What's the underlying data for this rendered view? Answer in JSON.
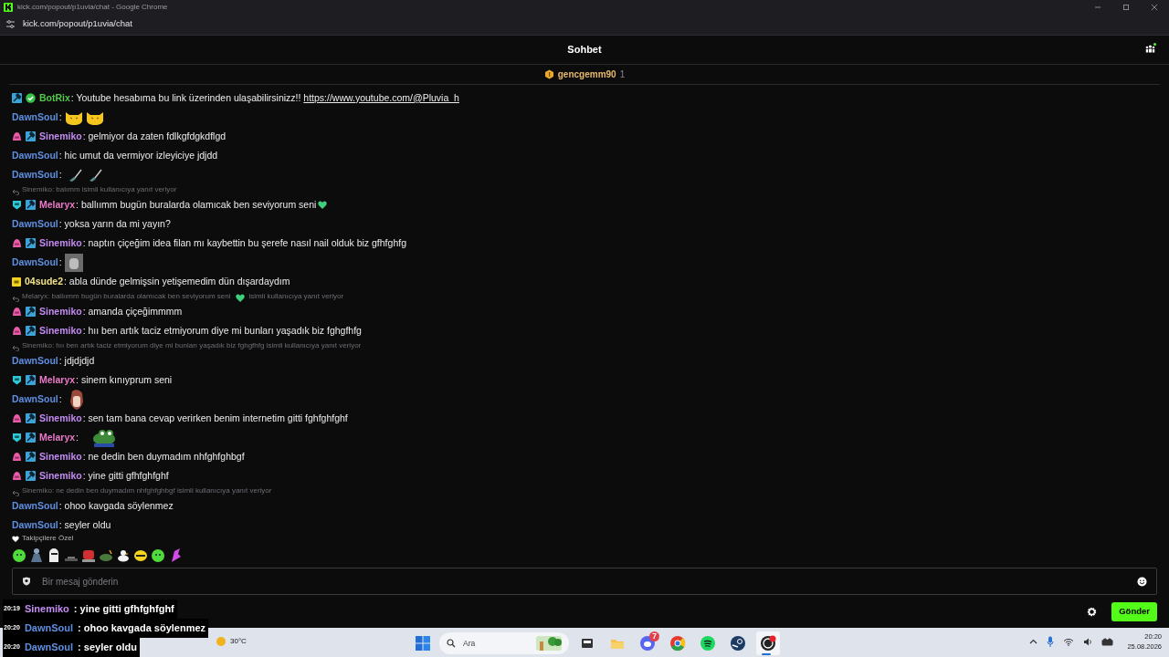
{
  "window": {
    "title": "kick.com/popout/p1uvia/chat - Google Chrome",
    "address": "kick.com/popout/p1uvia/chat"
  },
  "header": {
    "title": "Sohbet"
  },
  "pinned": {
    "name": "gencgemm90",
    "count": "1"
  },
  "messages": [
    {
      "badges": [
        {
          "kind": "hammer"
        },
        {
          "kind": "verified"
        }
      ],
      "name": "BotRix",
      "color": "#53c74a",
      "content": [
        {
          "kind": "text",
          "text": ": Youtube hesabıma bu link üzerinden ulaşabilirsinizz!! "
        },
        {
          "kind": "link",
          "text": "https://www.youtube.com/@Pluvia_h"
        }
      ]
    },
    {
      "name": "DawnSoul",
      "color": "#5f8fe0",
      "content": [
        {
          "kind": "text",
          "text": ":"
        },
        {
          "kind": "cat"
        },
        {
          "kind": "cat"
        }
      ]
    },
    {
      "badges": [
        {
          "kind": "sub-pink"
        },
        {
          "kind": "hammer"
        }
      ],
      "name": "Sinemiko",
      "color": "#c48cf2",
      "content": [
        {
          "kind": "text",
          "text": ": gelmiyor da zaten fdlkgfdgkdflgd"
        }
      ]
    },
    {
      "name": "DawnSoul",
      "color": "#5f8fe0",
      "content": [
        {
          "kind": "text",
          "text": ": hic umut da vermiyor izleyiciye jdjdd"
        }
      ]
    },
    {
      "name": "DawnSoul",
      "color": "#5f8fe0",
      "content": [
        {
          "kind": "text",
          "text": ":"
        },
        {
          "kind": "brush"
        },
        {
          "kind": "brush"
        }
      ]
    },
    {
      "reply": [
        {
          "kind": "text",
          "text": "Sinemiko: balımm isimli kullanıcıya yanıt veriyor"
        }
      ],
      "badges": [
        {
          "kind": "sub-teal"
        },
        {
          "kind": "hammer"
        }
      ],
      "name": "Melaryx",
      "color": "#ec79c8",
      "content": [
        {
          "kind": "text",
          "text": ": ballıımm bugün buralarda olamıcak ben seviyorum seni"
        },
        {
          "kind": "heart"
        }
      ]
    },
    {
      "name": "DawnSoul",
      "color": "#5f8fe0",
      "content": [
        {
          "kind": "text",
          "text": ": yoksa yarın da mi yayın?"
        }
      ]
    },
    {
      "badges": [
        {
          "kind": "sub-pink"
        },
        {
          "kind": "hammer"
        }
      ],
      "name": "Sinemiko",
      "color": "#c48cf2",
      "content": [
        {
          "kind": "text",
          "text": ": naptın çiçeğim idea filan mı kaybettin bu şerefe nasıl nail olduk biz gfhfghfg"
        }
      ]
    },
    {
      "name": "DawnSoul",
      "color": "#5f8fe0",
      "content": [
        {
          "kind": "text",
          "text": ":"
        },
        {
          "kind": "photo"
        }
      ]
    },
    {
      "badges": [
        {
          "kind": "sub-gold"
        }
      ],
      "name": "04sude2",
      "color": "#f2e38a",
      "content": [
        {
          "kind": "text",
          "text": ": abla dünde gelmişsin yetişemedim dün dışardaydım"
        }
      ]
    },
    {
      "reply": [
        {
          "kind": "text",
          "text": "Melaryx: ballıımm bugün buralarda olamıcak ben seviyorum seni"
        },
        {
          "kind": "heart"
        },
        {
          "kind": "text",
          "text": "isimli kullanıcıya yanıt veriyor"
        }
      ],
      "badges": [
        {
          "kind": "sub-pink"
        },
        {
          "kind": "hammer"
        }
      ],
      "name": "Sinemiko",
      "color": "#c48cf2",
      "content": [
        {
          "kind": "text",
          "text": ": amanda çiçeğimmmm"
        }
      ]
    },
    {
      "badges": [
        {
          "kind": "sub-pink"
        },
        {
          "kind": "hammer"
        }
      ],
      "name": "Sinemiko",
      "color": "#c48cf2",
      "content": [
        {
          "kind": "text",
          "text": ": hıı ben artık taciz etmiyorum diye mi bunları yaşadık biz fghgfhfg"
        }
      ]
    },
    {
      "reply": [
        {
          "kind": "text",
          "text": "Sinemiko: hıı ben artık taciz etmiyorum diye mi bunları yaşadık biz fghgfhfg isimli kullanıcıya yanıt veriyor"
        }
      ],
      "name": "DawnSoul",
      "color": "#5f8fe0",
      "content": [
        {
          "kind": "text",
          "text": ": jdjdjdjd"
        }
      ]
    },
    {
      "badges": [
        {
          "kind": "sub-teal"
        },
        {
          "kind": "hammer"
        }
      ],
      "name": "Melaryx",
      "color": "#ec79c8",
      "content": [
        {
          "kind": "text",
          "text": ": sinem kınıyprum seni"
        }
      ]
    },
    {
      "name": "DawnSoul",
      "color": "#5f8fe0",
      "content": [
        {
          "kind": "text",
          "text": ":"
        },
        {
          "kind": "anime"
        }
      ]
    },
    {
      "badges": [
        {
          "kind": "sub-pink"
        },
        {
          "kind": "hammer"
        }
      ],
      "name": "Sinemiko",
      "color": "#c48cf2",
      "content": [
        {
          "kind": "text",
          "text": ": sen tam bana cevap verirken benim internetim gitti fghfghfghf"
        }
      ]
    },
    {
      "badges": [
        {
          "kind": "sub-teal"
        },
        {
          "kind": "hammer"
        }
      ],
      "name": "Melaryx",
      "color": "#ec79c8",
      "content": [
        {
          "kind": "text",
          "text": ":"
        },
        {
          "kind": "frog"
        }
      ]
    },
    {
      "badges": [
        {
          "kind": "sub-pink"
        },
        {
          "kind": "hammer"
        }
      ],
      "name": "Sinemiko",
      "color": "#c48cf2",
      "content": [
        {
          "kind": "text",
          "text": ": ne dedin ben duymadım nhfghfghbgf"
        }
      ]
    },
    {
      "badges": [
        {
          "kind": "sub-pink"
        },
        {
          "kind": "hammer"
        }
      ],
      "name": "Sinemiko",
      "color": "#c48cf2",
      "content": [
        {
          "kind": "text",
          "text": ": yine gitti gfhfghfghf"
        }
      ]
    },
    {
      "reply": [
        {
          "kind": "text",
          "text": "Sinemiko: ne dedin ben duymadım nhfghfghbgf isimli kullanıcıya yanıt veriyor"
        }
      ],
      "name": "DawnSoul",
      "color": "#5f8fe0",
      "content": [
        {
          "kind": "text",
          "text": ": ohoo kavgada söylenmez"
        }
      ]
    },
    {
      "name": "DawnSoul",
      "color": "#5f8fe0",
      "content": [
        {
          "kind": "text",
          "text": ": seyler oldu"
        }
      ]
    }
  ],
  "followers_emotes": {
    "label": "Takipçilere Özel",
    "emotes": [
      {
        "kind": "blob"
      },
      {
        "kind": "person"
      },
      {
        "kind": "ghost"
      },
      {
        "kind": "hat"
      },
      {
        "kind": "monster"
      },
      {
        "kind": "turtle"
      },
      {
        "kind": "duck"
      },
      {
        "kind": "bee"
      },
      {
        "kind": "blob"
      },
      {
        "kind": "unicorn"
      }
    ]
  },
  "composer": {
    "placeholder": "Bir mesaj gönderin",
    "send": "Gönder"
  },
  "overlay_chat": [
    {
      "time": "20:19",
      "name": "Sinemiko",
      "color": "#c48cf2",
      "text": ": yine gitti gfhfghfghf"
    },
    {
      "time": "20:20",
      "name": "DawnSoul",
      "color": "#5f8fe0",
      "text": ": ohoo kavgada söylenmez"
    },
    {
      "time": "20:20",
      "name": "DawnSoul",
      "color": "#5f8fe0",
      "text": ": seyler oldu"
    }
  ],
  "taskbar": {
    "weather": "30°C",
    "search": "Ara",
    "apps": [
      {
        "kind": "taskview",
        "active": false
      },
      {
        "kind": "files",
        "active": false
      },
      {
        "kind": "discord",
        "active": false,
        "badge": "7"
      },
      {
        "kind": "chrome",
        "active": false
      },
      {
        "kind": "spotify",
        "active": false
      },
      {
        "kind": "steam",
        "active": false
      },
      {
        "kind": "obs",
        "active": true
      }
    ],
    "time": "20:20",
    "date": "25.08.2026"
  }
}
